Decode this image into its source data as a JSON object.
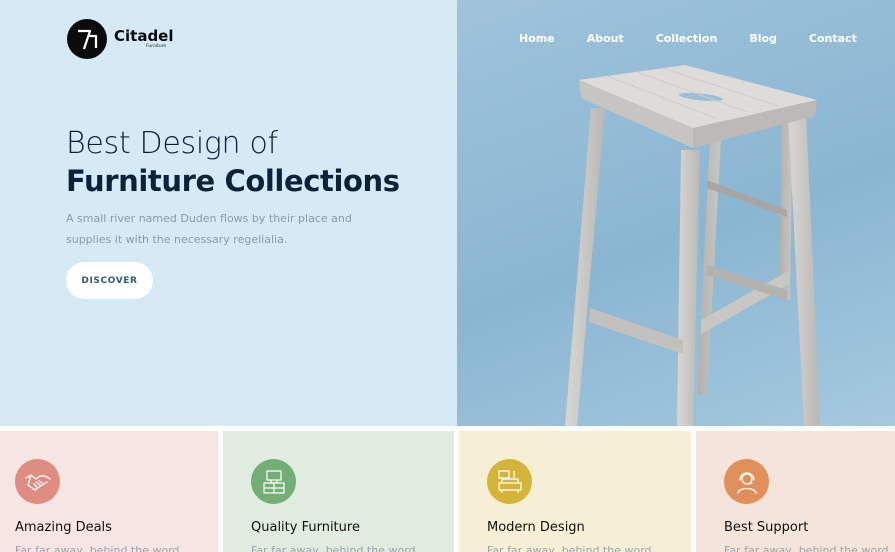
{
  "brand": {
    "name": "Citadel",
    "tagline": "Furniture"
  },
  "nav": {
    "items": [
      "Home",
      "About",
      "Collection",
      "Blog",
      "Contact"
    ]
  },
  "hero": {
    "headline_light": "Best Design of",
    "headline_bold": "Furniture Collections",
    "description": "A small river named Duden flows by their place and supplies it with the necessary regelialia.",
    "cta_label": "DISCOVER",
    "image_subject": "wooden-bar-stool"
  },
  "features": [
    {
      "title": "Amazing Deals",
      "description": "Far far away, behind the word",
      "icon": "handshake-icon",
      "bg": "#f7e5e3",
      "icon_bg": "#df8c82"
    },
    {
      "title": "Quality Furniture",
      "description": "Far far away, behind the word",
      "icon": "furniture-icon",
      "bg": "#e0ece0",
      "icon_bg": "#73ae77"
    },
    {
      "title": "Modern Design",
      "description": "Far far away, behind the word",
      "icon": "armchair-icon",
      "bg": "#f6efd6",
      "icon_bg": "#d5b43a"
    },
    {
      "title": "Best Support",
      "description": "Far far away, behind the word",
      "icon": "support-agent-icon",
      "bg": "#f5e4da",
      "icon_bg": "#e0905b"
    }
  ]
}
